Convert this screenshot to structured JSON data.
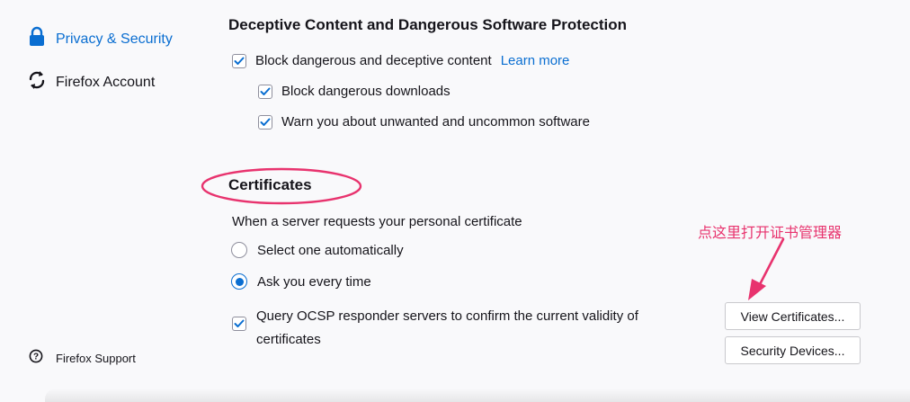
{
  "sidebar": {
    "items": [
      {
        "label": "Privacy & Security",
        "icon": "lock-icon",
        "active": true
      },
      {
        "label": "Firefox Account",
        "icon": "sync-icon",
        "active": false
      }
    ],
    "support_label": "Firefox Support"
  },
  "deceptive": {
    "title": "Deceptive Content and Dangerous Software Protection",
    "block_label": "Block dangerous and deceptive content",
    "learn_more": "Learn more",
    "downloads_label": "Block dangerous downloads",
    "unwanted_label": "Warn you about unwanted and uncommon software",
    "block_checked": true,
    "downloads_checked": true,
    "unwanted_checked": true
  },
  "certificates": {
    "title": "Certificates",
    "prompt": "When a server requests your personal certificate",
    "option_auto": "Select one automatically",
    "option_ask": "Ask you every time",
    "selected": "ask",
    "ocsp_line1": "Query OCSP responder servers to confirm the current validity of",
    "ocsp_line2": "certificates",
    "ocsp_checked": true,
    "view_button": "View Certificates...",
    "devices_button": "Security Devices..."
  },
  "annotation": {
    "text": "点这里打开证书管理器"
  },
  "colors": {
    "accent": "#0a6ed1",
    "annotation": "#e8336e",
    "background": "#f9f9fb"
  }
}
